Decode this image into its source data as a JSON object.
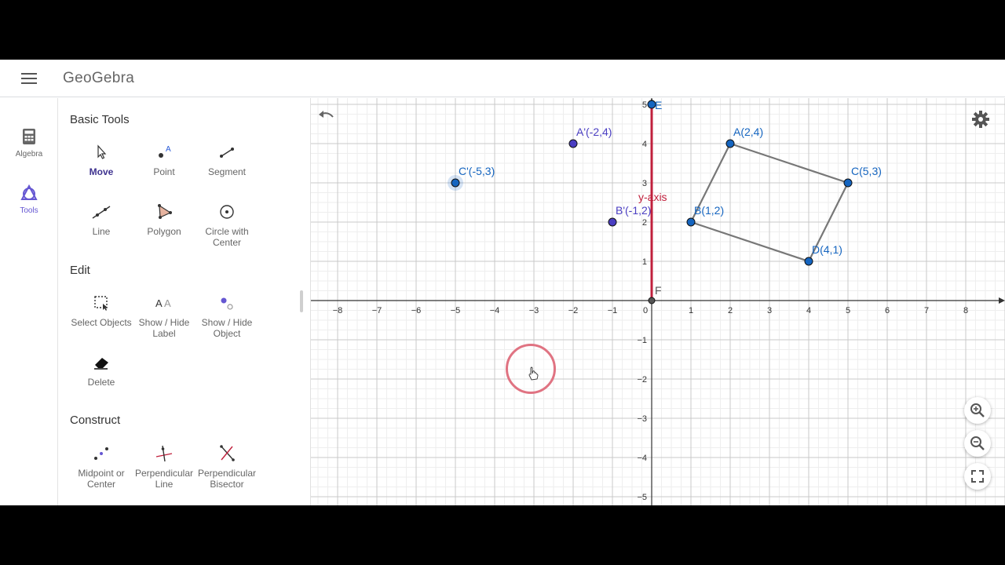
{
  "app": {
    "title": "GeoGebra"
  },
  "rail": {
    "items": [
      {
        "label": "Algebra",
        "icon": "calculator-icon"
      },
      {
        "label": "Tools",
        "icon": "tools-shapes-icon",
        "active": true
      }
    ]
  },
  "tools": {
    "sections": [
      {
        "title": "Basic Tools"
      },
      {
        "title": "Edit"
      },
      {
        "title": "Construct"
      }
    ],
    "items": [
      {
        "label": "Move",
        "icon": "arrow-cursor-icon",
        "selected": true
      },
      {
        "label": "Point",
        "icon": "point-tool-icon"
      },
      {
        "label": "Segment",
        "icon": "segment-tool-icon"
      },
      {
        "label": "Line",
        "icon": "line-tool-icon"
      },
      {
        "label": "Polygon",
        "icon": "polygon-tool-icon"
      },
      {
        "label": "Circle with Center",
        "icon": "circle-center-tool-icon"
      },
      {
        "label": "Select Objects",
        "icon": "select-objects-icon"
      },
      {
        "label": "Show / Hide Label",
        "icon": "show-hide-label-icon"
      },
      {
        "label": "Show / Hide Object",
        "icon": "show-hide-object-icon"
      },
      {
        "label": "Delete",
        "icon": "eraser-icon"
      },
      {
        "label": "Midpoint or Center",
        "icon": "midpoint-tool-icon"
      },
      {
        "label": "Perpendicular Line",
        "icon": "perpendicular-line-icon"
      },
      {
        "label": "Perpendicular Bisector",
        "icon": "perpendicular-bisector-icon"
      }
    ]
  },
  "graphics": {
    "x_range": [
      -8.6,
      9.0
    ],
    "y_range": [
      -5.2,
      5.2
    ],
    "x_ticks": [
      "−8",
      "−7",
      "−6",
      "−5",
      "−4",
      "−3",
      "−2",
      "−1",
      "0",
      "1",
      "2",
      "3",
      "4",
      "5",
      "6",
      "7",
      "8"
    ],
    "y_ticks": [
      "5",
      "4",
      "3",
      "2",
      "1",
      "−1",
      "−2",
      "−3",
      "−4",
      "−5"
    ],
    "y_axis_label": "y-axis",
    "points": [
      {
        "name": "A(2,4)",
        "x": 2,
        "y": 4,
        "color": "#1565c0"
      },
      {
        "name": "B(1,2)",
        "x": 1,
        "y": 2,
        "color": "#1565c0"
      },
      {
        "name": "C(5,3)",
        "x": 5,
        "y": 3,
        "color": "#1565c0"
      },
      {
        "name": "D(4,1)",
        "x": 4,
        "y": 1,
        "color": "#1565c0"
      },
      {
        "name": "A'(-2,4)",
        "x": -2,
        "y": 4,
        "color": "#4a3ec2"
      },
      {
        "name": "B'(-1,2)",
        "x": -1,
        "y": 2,
        "color": "#4a3ec2"
      },
      {
        "name": "C'(-5,3)",
        "x": -5,
        "y": 3,
        "color": "#1565c0"
      },
      {
        "name": "E",
        "x": 0,
        "y": 5,
        "color": "#1565c0"
      },
      {
        "name": "F",
        "x": 0,
        "y": 0,
        "color": "#555555"
      }
    ],
    "polygon": [
      "A(2,4)",
      "C(5,3)",
      "D(4,1)",
      "B(1,2)"
    ],
    "colors": {
      "accent": "#6557d2",
      "y_axis_line": "#c0203c",
      "polygon_edge": "#777777"
    }
  }
}
